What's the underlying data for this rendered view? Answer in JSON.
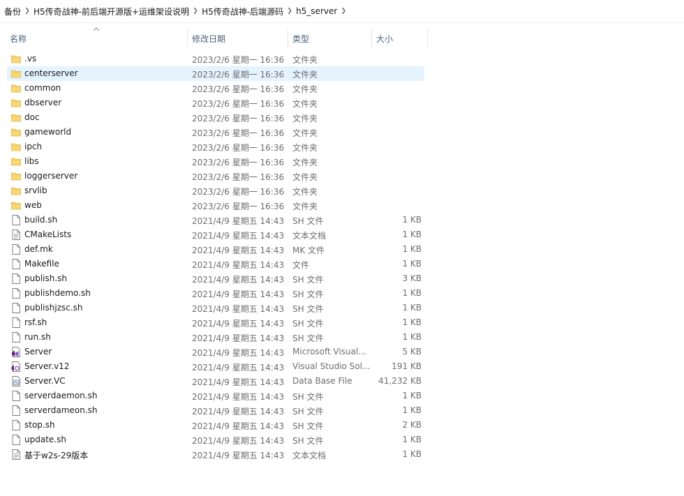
{
  "breadcrumb": [
    "备份",
    "H5传奇战神-前后端开源版+运维架设说明",
    "H5传奇战神-后端源码",
    "h5_server"
  ],
  "columns": {
    "name": "名称",
    "date": "修改日期",
    "type": "类型",
    "size": "大小"
  },
  "accent": "#e5f3ff",
  "rows": [
    {
      "name": ".vs",
      "date": "2023/2/6 星期一 16:36",
      "type": "文件夹",
      "size": "",
      "icon": "folder-icon"
    },
    {
      "name": "centerserver",
      "date": "2023/2/6 星期一 16:36",
      "type": "文件夹",
      "size": "",
      "icon": "folder-icon",
      "selected": true
    },
    {
      "name": "common",
      "date": "2023/2/6 星期一 16:36",
      "type": "文件夹",
      "size": "",
      "icon": "folder-icon"
    },
    {
      "name": "dbserver",
      "date": "2023/2/6 星期一 16:36",
      "type": "文件夹",
      "size": "",
      "icon": "folder-icon"
    },
    {
      "name": "doc",
      "date": "2023/2/6 星期一 16:36",
      "type": "文件夹",
      "size": "",
      "icon": "folder-icon"
    },
    {
      "name": "gameworld",
      "date": "2023/2/6 星期一 16:36",
      "type": "文件夹",
      "size": "",
      "icon": "folder-icon"
    },
    {
      "name": "ipch",
      "date": "2023/2/6 星期一 16:36",
      "type": "文件夹",
      "size": "",
      "icon": "folder-icon"
    },
    {
      "name": "libs",
      "date": "2023/2/6 星期一 16:36",
      "type": "文件夹",
      "size": "",
      "icon": "folder-icon"
    },
    {
      "name": "loggerserver",
      "date": "2023/2/6 星期一 16:36",
      "type": "文件夹",
      "size": "",
      "icon": "folder-icon"
    },
    {
      "name": "srvlib",
      "date": "2023/2/6 星期一 16:36",
      "type": "文件夹",
      "size": "",
      "icon": "folder-icon"
    },
    {
      "name": "web",
      "date": "2023/2/6 星期一 16:36",
      "type": "文件夹",
      "size": "",
      "icon": "folder-icon"
    },
    {
      "name": "build.sh",
      "date": "2021/4/9 星期五 14:43",
      "type": "SH 文件",
      "size": "1 KB",
      "icon": "file-icon"
    },
    {
      "name": "CMakeLists",
      "date": "2021/4/9 星期五 14:43",
      "type": "文本文档",
      "size": "1 KB",
      "icon": "text-file-icon"
    },
    {
      "name": "def.mk",
      "date": "2021/4/9 星期五 14:43",
      "type": "MK 文件",
      "size": "1 KB",
      "icon": "file-icon"
    },
    {
      "name": "Makefile",
      "date": "2021/4/9 星期五 14:43",
      "type": "文件",
      "size": "1 KB",
      "icon": "file-icon"
    },
    {
      "name": "publish.sh",
      "date": "2021/4/9 星期五 14:43",
      "type": "SH 文件",
      "size": "3 KB",
      "icon": "file-icon"
    },
    {
      "name": "publishdemo.sh",
      "date": "2021/4/9 星期五 14:43",
      "type": "SH 文件",
      "size": "1 KB",
      "icon": "file-icon"
    },
    {
      "name": "publishjzsc.sh",
      "date": "2021/4/9 星期五 14:43",
      "type": "SH 文件",
      "size": "1 KB",
      "icon": "file-icon"
    },
    {
      "name": "rsf.sh",
      "date": "2021/4/9 星期五 14:43",
      "type": "SH 文件",
      "size": "1 KB",
      "icon": "file-icon"
    },
    {
      "name": "run.sh",
      "date": "2021/4/9 星期五 14:43",
      "type": "SH 文件",
      "size": "1 KB",
      "icon": "file-icon"
    },
    {
      "name": "Server",
      "date": "2021/4/9 星期五 14:43",
      "type": "Microsoft Visual...",
      "size": "5 KB",
      "icon": "visual-studio-solution-icon"
    },
    {
      "name": "Server.v12",
      "date": "2021/4/9 星期五 14:43",
      "type": "Visual Studio Sol...",
      "size": "191 KB",
      "icon": "visual-studio-options-icon"
    },
    {
      "name": "Server.VC",
      "date": "2021/4/9 星期五 14:43",
      "type": "Data Base File",
      "size": "41,232 KB",
      "icon": "database-file-icon"
    },
    {
      "name": "serverdaemon.sh",
      "date": "2021/4/9 星期五 14:43",
      "type": "SH 文件",
      "size": "1 KB",
      "icon": "file-icon"
    },
    {
      "name": "serverdameon.sh",
      "date": "2021/4/9 星期五 14:43",
      "type": "SH 文件",
      "size": "1 KB",
      "icon": "file-icon"
    },
    {
      "name": "stop.sh",
      "date": "2021/4/9 星期五 14:43",
      "type": "SH 文件",
      "size": "2 KB",
      "icon": "file-icon"
    },
    {
      "name": "update.sh",
      "date": "2021/4/9 星期五 14:43",
      "type": "SH 文件",
      "size": "1 KB",
      "icon": "file-icon"
    },
    {
      "name": "基于w2s-29版本",
      "date": "2021/4/9 星期五 14:43",
      "type": "文本文档",
      "size": "1 KB",
      "icon": "text-file-icon"
    }
  ]
}
